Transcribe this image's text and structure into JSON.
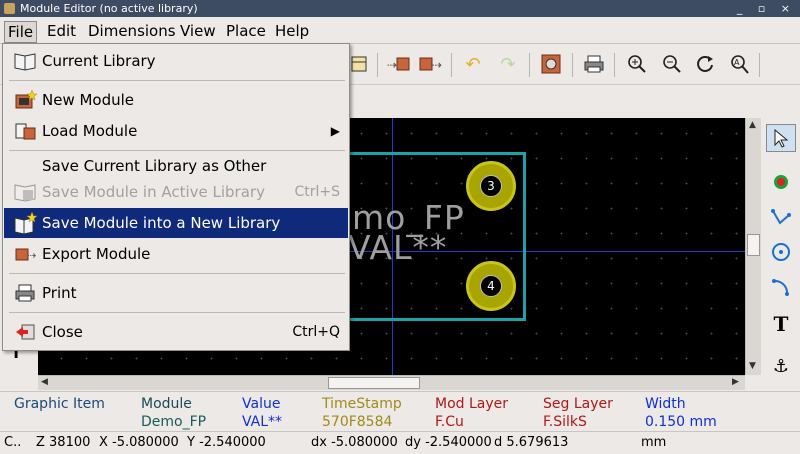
{
  "window": {
    "title": "Module Editor (no active library)",
    "controls": "_ ▫ ×"
  },
  "menubar": {
    "items": [
      "File",
      "Edit",
      "Dimensions",
      "View",
      "Place",
      "Help"
    ],
    "active": "File"
  },
  "file_menu": {
    "current_library": "Current Library",
    "new_module": "New Module",
    "load_module": "Load Module",
    "save_current_library_as_other": "Save Current Library as Other",
    "save_module_active_library": "Save Module in Active Library",
    "save_module_active_library_shortcut": "Ctrl+S",
    "save_module_new_library": "Save Module into a New Library",
    "export_module": "Export Module",
    "print": "Print",
    "close": "Close",
    "close_shortcut": "Ctrl+Q"
  },
  "canvas": {
    "ref_text": "mo_FP",
    "value_text": "VAL**",
    "pads": [
      "3",
      "4"
    ],
    "colors": {
      "background": "#000000",
      "outline": "#1aa3a8",
      "pad": "#a8a400",
      "silk": "#9f9f9f",
      "axis": "#1f3bd0"
    }
  },
  "left_strip": {
    "marker": "T"
  },
  "msgpanel": {
    "graphic_item": "Graphic Item",
    "module_label": "Module",
    "module_value": "Demo_FP",
    "value_label": "Value",
    "value_value": "VAL**",
    "timestamp_label": "TimeStamp",
    "timestamp_value": "570F8584",
    "modlayer_label": "Mod Layer",
    "modlayer_value": "F.Cu",
    "seglayer_label": "Seg Layer",
    "seglayer_value": "F.SilkS",
    "width_label": "Width",
    "width_value": "0.150 mm"
  },
  "statusbar": {
    "left": "C..",
    "zoom": "Z 38100",
    "x": "X -5.080000",
    "y": "Y -2.540000",
    "dx": "dx -5.080000",
    "dy": "dy -2.540000",
    "d": "d 5.679613",
    "units": "mm"
  }
}
